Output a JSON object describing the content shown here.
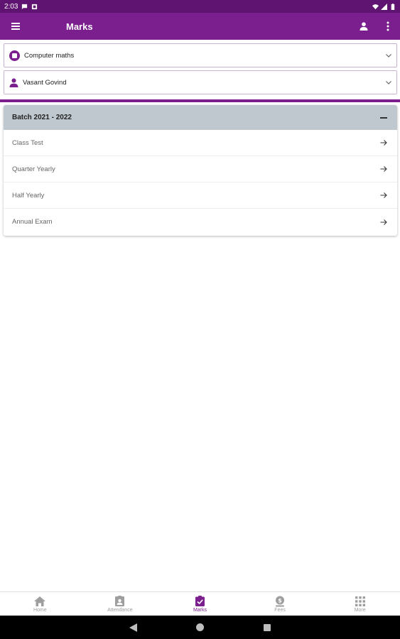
{
  "status_bar": {
    "time": "2:03"
  },
  "app_bar": {
    "title": "Marks"
  },
  "selectors": {
    "subject": "Computer maths",
    "student": "Vasant  Govind"
  },
  "batch": {
    "title": "Batch 2021 - 2022",
    "items": [
      {
        "label": "Class Test"
      },
      {
        "label": "Quarter Yearly"
      },
      {
        "label": "Half Yearly"
      },
      {
        "label": "Annual Exam"
      }
    ]
  },
  "bottom_nav": [
    {
      "label": "Home",
      "icon": "home-icon"
    },
    {
      "label": "Attendance",
      "icon": "attendance-icon"
    },
    {
      "label": "Marks",
      "icon": "marks-icon",
      "active": true
    },
    {
      "label": "Fees",
      "icon": "fees-icon"
    },
    {
      "label": "More",
      "icon": "grid-icon"
    }
  ],
  "colors": {
    "primary": "#7b1f8f",
    "status_bar": "#5e1470",
    "batch_header": "#c0c8cf",
    "nav_inactive": "#9e9e9e"
  }
}
